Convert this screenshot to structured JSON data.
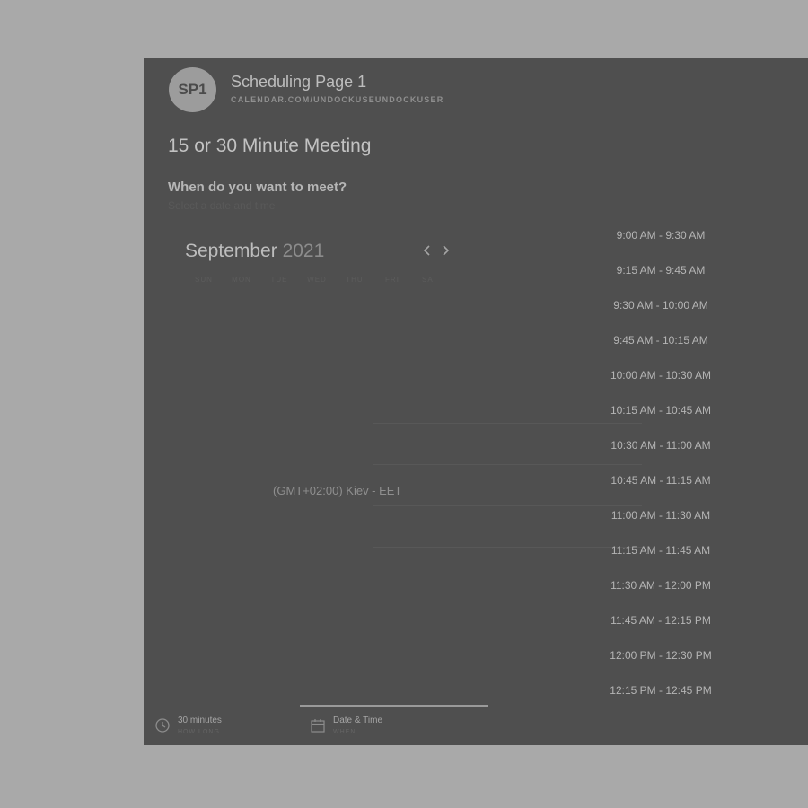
{
  "header": {
    "avatar_initials": "SP1",
    "page_name": "Scheduling Page 1",
    "page_url": "CALENDAR.COM/UNDOCKUSEUNDOCKUSER"
  },
  "meeting": {
    "title": "15 or 30 Minute Meeting",
    "question": "When do you want to meet?",
    "hint": "Select a date and time"
  },
  "calendar": {
    "month": "September",
    "year": "2021",
    "weekdays": [
      "SUN",
      "MON",
      "TUE",
      "WED",
      "THU",
      "FRI",
      "SAT"
    ],
    "prev_icon": "chevron-left-icon",
    "next_icon": "chevron-right-icon"
  },
  "timezone": "(GMT+02:00) Kiev - EET",
  "time_slots": [
    "9:00 AM - 9:30 AM",
    "9:15 AM - 9:45 AM",
    "9:30 AM - 10:00 AM",
    "9:45 AM - 10:15 AM",
    "10:00 AM - 10:30 AM",
    "10:15 AM - 10:45 AM",
    "10:30 AM - 11:00 AM",
    "10:45 AM - 11:15 AM",
    "11:00 AM - 11:30 AM",
    "11:15 AM - 11:45 AM",
    "11:30 AM - 12:00 PM",
    "11:45 AM - 12:15 PM",
    "12:00 PM - 12:30 PM",
    "12:15 PM - 12:45 PM"
  ],
  "steps": [
    {
      "label": "30 minutes",
      "sub": "HOW LONG",
      "icon": "clock-icon"
    },
    {
      "label": "Date & Time",
      "sub": "WHEN",
      "icon": "calendar-icon"
    }
  ],
  "colors": {
    "page_background": "#a9a9a9",
    "panel_background": "#4f4f4f",
    "avatar": "#9c9c9c"
  }
}
